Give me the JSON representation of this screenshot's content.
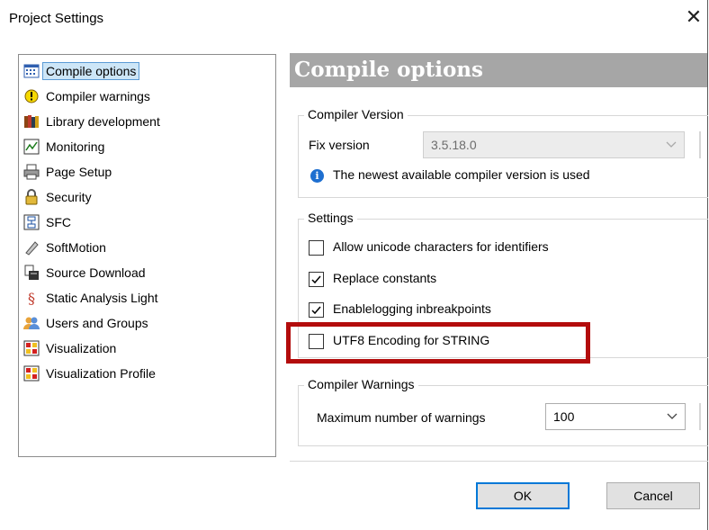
{
  "window": {
    "title": "Project Settings",
    "close_icon": "close-icon"
  },
  "sidebar": {
    "items": [
      {
        "label": "Compile options",
        "icon": "compile-options-icon",
        "selected": true
      },
      {
        "label": "Compiler warnings",
        "icon": "warning-icon"
      },
      {
        "label": "Library development",
        "icon": "library-icon"
      },
      {
        "label": "Monitoring",
        "icon": "monitoring-icon"
      },
      {
        "label": "Page Setup",
        "icon": "printer-icon"
      },
      {
        "label": "Security",
        "icon": "lock-icon"
      },
      {
        "label": "SFC",
        "icon": "sfc-icon"
      },
      {
        "label": "SoftMotion",
        "icon": "softmotion-icon"
      },
      {
        "label": "Source Download",
        "icon": "source-download-icon"
      },
      {
        "label": "Static Analysis Light",
        "icon": "paragraph-icon"
      },
      {
        "label": "Users and Groups",
        "icon": "users-icon"
      },
      {
        "label": "Visualization",
        "icon": "visualization-icon"
      },
      {
        "label": "Visualization Profile",
        "icon": "visualization-profile-icon"
      }
    ]
  },
  "main": {
    "header": "Compile options",
    "compiler_version": {
      "group_label": "Compiler Version",
      "fix_version_label": "Fix version",
      "fix_version_value": "3.5.18.0",
      "info_text": "The newest available compiler version is used"
    },
    "settings": {
      "group_label": "Settings",
      "options": [
        {
          "label": "Allow unicode characters for identifiers",
          "checked": false
        },
        {
          "label": "Replace constants",
          "checked": true
        },
        {
          "label": "Enablelogging inbreakpoints",
          "checked": true
        },
        {
          "label": "UTF8 Encoding for STRING",
          "checked": false,
          "highlighted": true
        }
      ]
    },
    "compiler_warnings": {
      "group_label": "Compiler Warnings",
      "max_label": "Maximum number of warnings",
      "max_value": "100"
    }
  },
  "buttons": {
    "ok": "OK",
    "cancel": "Cancel"
  },
  "colors": {
    "header_bg": "#a6a6a6",
    "highlight": "#b30c0c",
    "selection": "#cde6f7",
    "accent": "#0078d7"
  }
}
